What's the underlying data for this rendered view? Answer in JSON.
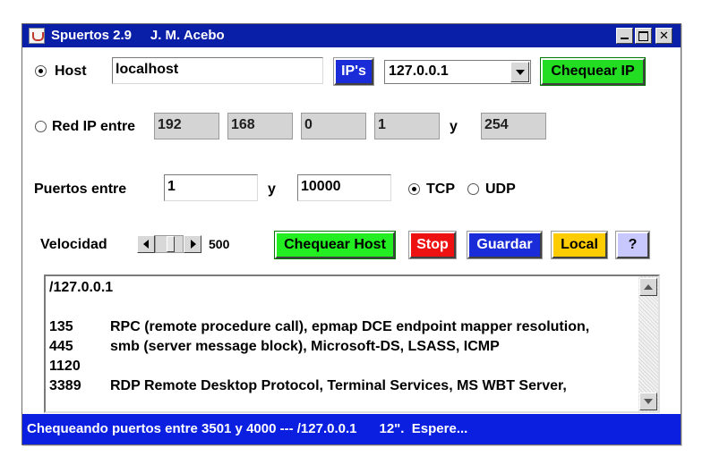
{
  "window": {
    "title": "Spuertos 2.9     J. M. Acebo"
  },
  "colors": {
    "titlebar": "#0a1fa8",
    "statusbar": "#0a1fe0",
    "ips_button": "#1a2bd8",
    "check_ip_button": "#22dd22",
    "check_host_button": "#22ee22",
    "stop_button": "#ee1111",
    "save_button": "#1a2bd8",
    "local_button": "#ffcc00",
    "help_button": "#c8c8ff"
  },
  "host": {
    "label": "Host",
    "selected": true,
    "value": "localhost",
    "ips_button": "IP's",
    "ip_select_value": "127.0.0.1",
    "check_ip_button": "Chequear IP"
  },
  "range": {
    "label": "Red IP entre",
    "selected": false,
    "octet1": "192",
    "octet2": "168",
    "octet3": "0",
    "octet4": "1",
    "and_label": "y",
    "end": "254"
  },
  "ports": {
    "label": "Puertos entre",
    "from": "1",
    "and_label": "y",
    "to": "10000",
    "tcp_label": "TCP",
    "tcp_selected": true,
    "udp_label": "UDP",
    "udp_selected": false
  },
  "speed": {
    "label": "Velocidad",
    "value": "500",
    "check_host_button": "Chequear Host",
    "stop_button": "Stop",
    "save_button": "Guardar",
    "local_button": "Local",
    "help_button": "?"
  },
  "output": {
    "header": "/127.0.0.1",
    "rows": [
      {
        "port": "135",
        "desc": "RPC (remote procedure call), epmap DCE endpoint mapper resolution,"
      },
      {
        "port": "445",
        "desc": "smb (server message block), Microsoft-DS, LSASS, ICMP"
      },
      {
        "port": "1120",
        "desc": ""
      },
      {
        "port": "3389",
        "desc": "RDP Remote Desktop Protocol, Terminal Services, MS WBT Server,"
      }
    ]
  },
  "status": {
    "text": "Chequeando puertos entre 3501 y 4000 --- /127.0.0.1      12\".  Espere..."
  }
}
